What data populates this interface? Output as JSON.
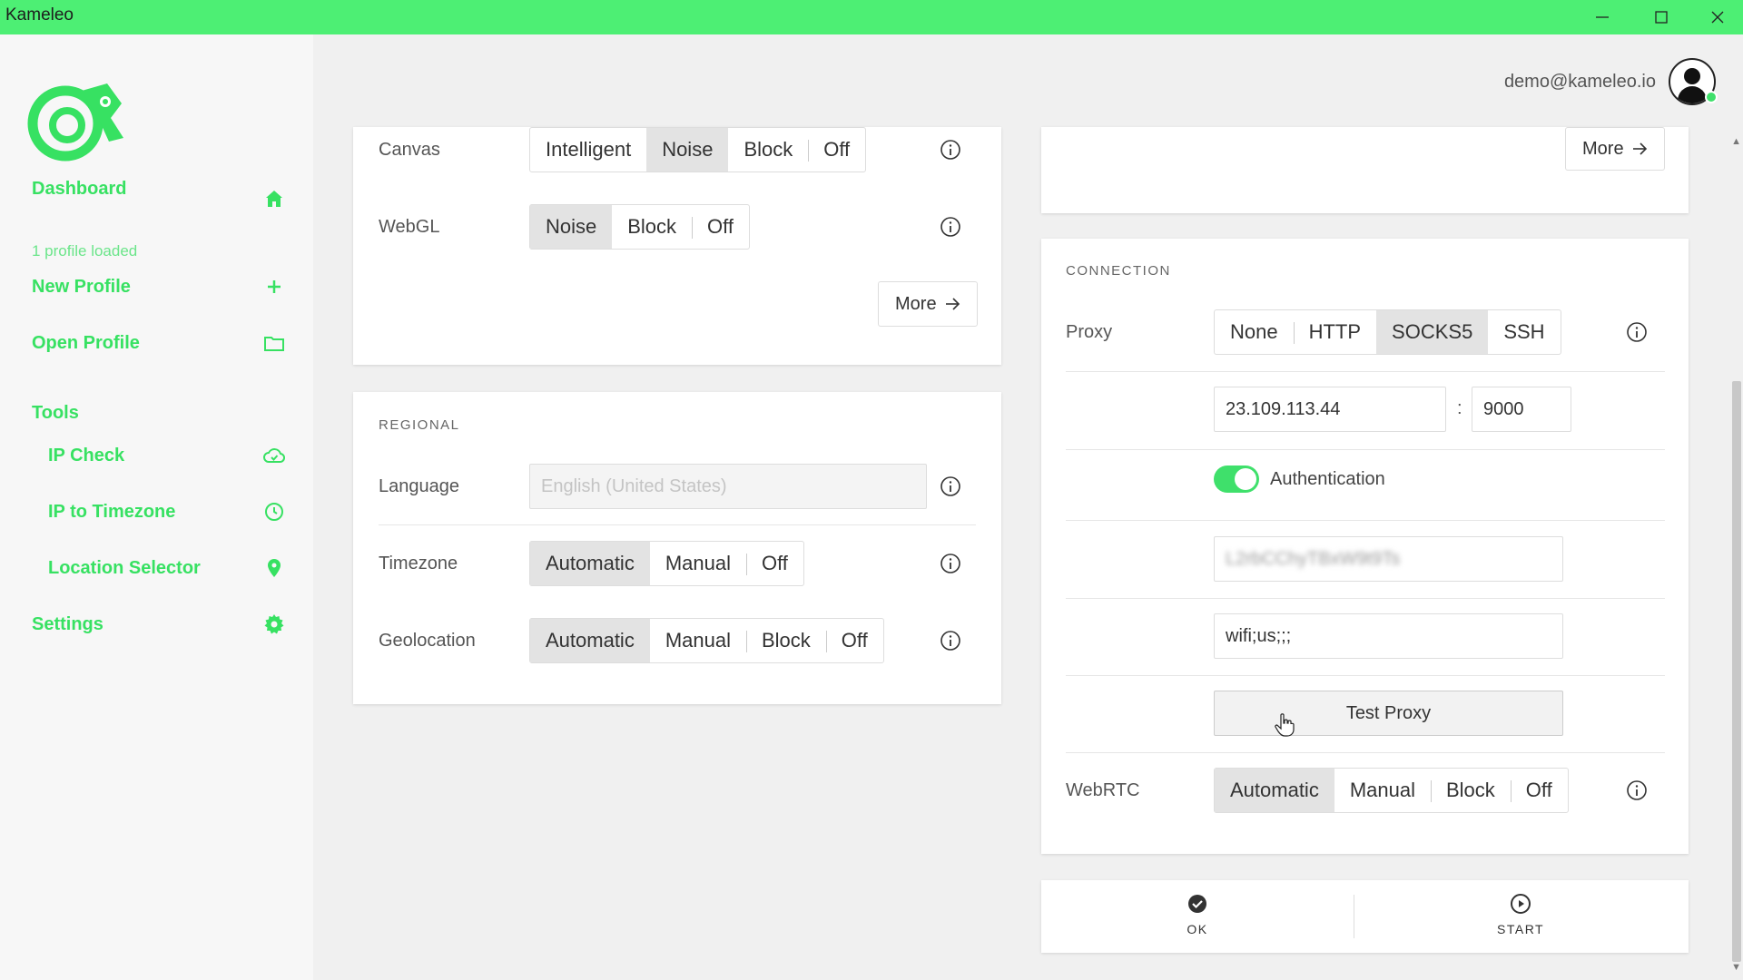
{
  "window": {
    "title": "Kameleo"
  },
  "sidebar": {
    "dashboard": {
      "label": "Dashboard",
      "sub": "1 profile loaded"
    },
    "new_profile": "New Profile",
    "open_profile": "Open Profile",
    "tools": "Tools",
    "ip_check": "IP Check",
    "ip_timezone": "IP to Timezone",
    "location_selector": "Location Selector",
    "settings": "Settings"
  },
  "user": {
    "email": "demo@kameleo.io"
  },
  "fingerprint": {
    "canvas": {
      "label": "Canvas",
      "options": [
        "Intelligent",
        "Noise",
        "Block",
        "Off"
      ],
      "selected": "Noise"
    },
    "webgl": {
      "label": "WebGL",
      "options": [
        "Noise",
        "Block",
        "Off"
      ],
      "selected": "Noise"
    },
    "more": "More"
  },
  "regional": {
    "title": "REGIONAL",
    "language": {
      "label": "Language",
      "placeholder": "English (United States)"
    },
    "timezone": {
      "label": "Timezone",
      "options": [
        "Automatic",
        "Manual",
        "Off"
      ],
      "selected": "Automatic"
    },
    "geolocation": {
      "label": "Geolocation",
      "options": [
        "Automatic",
        "Manual",
        "Block",
        "Off"
      ],
      "selected": "Automatic"
    }
  },
  "right_top": {
    "more": "More"
  },
  "connection": {
    "title": "CONNECTION",
    "proxy": {
      "label": "Proxy",
      "options": [
        "None",
        "HTTP",
        "SOCKS5",
        "SSH"
      ],
      "selected": "SOCKS5"
    },
    "host": "23.109.113.44",
    "separator": ":",
    "port": "9000",
    "auth_label": "Authentication",
    "auth_enabled": true,
    "username_masked": "L2rbCChyTBxW9t9Ts",
    "password": "wifi;us;;;",
    "test_proxy": "Test Proxy",
    "webrtc": {
      "label": "WebRTC",
      "options": [
        "Automatic",
        "Manual",
        "Block",
        "Off"
      ],
      "selected": "Automatic"
    }
  },
  "actions": {
    "ok": "OK",
    "start": "START"
  },
  "colors": {
    "accent": "#37e162",
    "titlebar": "#4def74"
  }
}
